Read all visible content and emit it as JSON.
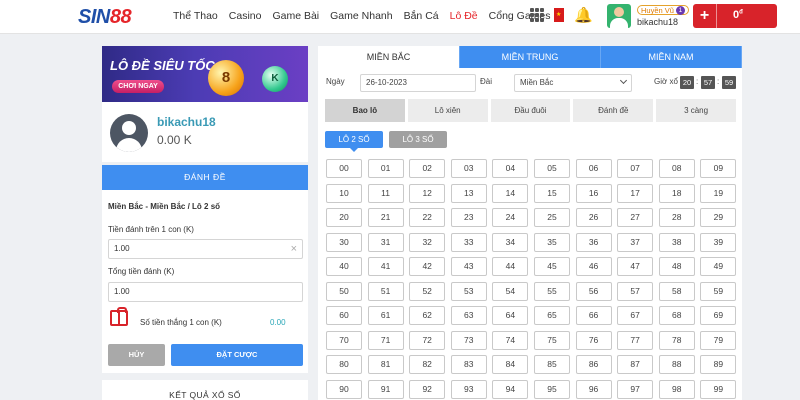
{
  "brand": {
    "part1": "SIN",
    "part2": "88"
  },
  "nav": [
    "Thể Thao",
    "Casino",
    "Game Bài",
    "Game Nhanh",
    "Bắn Cá",
    "Lô Đề",
    "Cổng Games"
  ],
  "user": {
    "rank": "Huyền Vũ",
    "rank_level": "1",
    "username": "bikachu18"
  },
  "wallet": {
    "plus": "+",
    "amount": "0",
    "currency": "đ"
  },
  "banner": {
    "title": "LÔ ĐỀ SIÊU TỐC",
    "cta": "CHƠI NGAY",
    "ball1": "8",
    "ball2": "K"
  },
  "profile": {
    "name": "bikachu18",
    "balance": "0.00 K"
  },
  "bet_form": {
    "header": "ĐÁNH ĐỀ",
    "path": "Miền Bắc - Miền Bắc / Lô 2 số",
    "stake_label": "Tiền đánh trên 1 con (K)",
    "stake_value": "1.00",
    "clear": "×",
    "total_label": "Tổng tiền đánh (K)",
    "total_value": "1.00",
    "win_label": "Số tiền thắng 1 con (K)",
    "win_value": "0.00",
    "cancel": "HỦY",
    "submit": "ĐẶT CƯỢC"
  },
  "results": {
    "title": "KẾT QUẢ XỔ SỐ"
  },
  "region_tabs": [
    "MIỀN BẮC",
    "MIỀN TRUNG",
    "MIỀN NAM"
  ],
  "active_region": 0,
  "filters": {
    "date_label": "Ngày",
    "date_value": "26-10-2023",
    "station_label": "Đài",
    "station_value": "Miền Bắc",
    "time_label": "Giờ xổ",
    "time_h": "20",
    "time_m": "57",
    "time_s": "59",
    "sep": ":"
  },
  "bet_types": [
    "Bao lô",
    "Lô xiên",
    "Đầu đuôi",
    "Đánh đề",
    "3 càng"
  ],
  "active_bet_type": 0,
  "sub_tabs": [
    "LÔ 2 SỐ",
    "LÔ 3 SỐ"
  ],
  "active_sub_tab": 0,
  "numbers": [
    "00",
    "01",
    "02",
    "03",
    "04",
    "05",
    "06",
    "07",
    "08",
    "09",
    "10",
    "11",
    "12",
    "13",
    "14",
    "15",
    "16",
    "17",
    "18",
    "19",
    "20",
    "21",
    "22",
    "23",
    "24",
    "25",
    "26",
    "27",
    "28",
    "29",
    "30",
    "31",
    "32",
    "33",
    "34",
    "35",
    "36",
    "37",
    "38",
    "39",
    "40",
    "41",
    "42",
    "43",
    "44",
    "45",
    "46",
    "47",
    "48",
    "49",
    "50",
    "51",
    "52",
    "53",
    "54",
    "55",
    "56",
    "57",
    "58",
    "59",
    "60",
    "61",
    "62",
    "63",
    "64",
    "65",
    "66",
    "67",
    "68",
    "69",
    "70",
    "71",
    "72",
    "73",
    "74",
    "75",
    "76",
    "77",
    "78",
    "79",
    "80",
    "81",
    "82",
    "83",
    "84",
    "85",
    "86",
    "87",
    "88",
    "89",
    "90",
    "91",
    "92",
    "93",
    "94",
    "95",
    "96",
    "97",
    "98",
    "99"
  ],
  "colors": {
    "accent": "#3f8ef0",
    "brand_red": "#e5252a",
    "brand_blue": "#1f4fa8",
    "link_teal": "#3a9ab5"
  }
}
